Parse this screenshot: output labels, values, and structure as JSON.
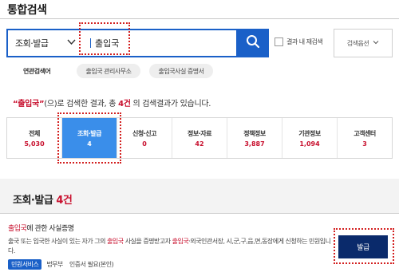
{
  "page": {
    "title": "통합검색"
  },
  "search": {
    "category": "조회·발급",
    "query": "출입국",
    "rescan_label": "결과 내 재검색",
    "options_label": "검색옵션"
  },
  "related": {
    "label": "연관검색어",
    "chips": [
      "출입국 관리사무소",
      "출입국사실 증명서"
    ]
  },
  "summary": {
    "open_quote": "“",
    "keyword": "출입국",
    "close_quote": "”",
    "part1": "(으)로 검색한 결과, 총 ",
    "count": "4건",
    "part2": " 의 검색결과가 있습니다."
  },
  "tabs": [
    {
      "label": "전체",
      "count": "5,030"
    },
    {
      "label": "조회·발급",
      "count": "4"
    },
    {
      "label": "신청·신고",
      "count": "0"
    },
    {
      "label": "정보·자료",
      "count": "42"
    },
    {
      "label": "정책정보",
      "count": "3,887"
    },
    {
      "label": "기관정보",
      "count": "1,094"
    },
    {
      "label": "고객센터",
      "count": "3"
    }
  ],
  "active_tab": 1,
  "section": {
    "title": "조회·발급",
    "count": "4건"
  },
  "result": {
    "title_kw": "출입국",
    "title_rest": "에 관한 사실증명",
    "desc_1": "출국 또는 입국한 사실이 있는 자가 그의 ",
    "desc_kw1": "출입국",
    "desc_2": " 사실을 증명받고자 ",
    "desc_kw2": "출입국",
    "desc_3": "·외국인관서장, 시,군,구,읍,면,동장에게 신청하는 민원입니다.",
    "tag": "민원서비스",
    "org": "법무부",
    "req": "인증서 필요(본인)",
    "button": "발급"
  },
  "colors": {
    "primary": "#1a60c8",
    "accent_red": "#c8102e",
    "active_tab": "#3a8eea",
    "issue_button": "#0a2a6b"
  }
}
